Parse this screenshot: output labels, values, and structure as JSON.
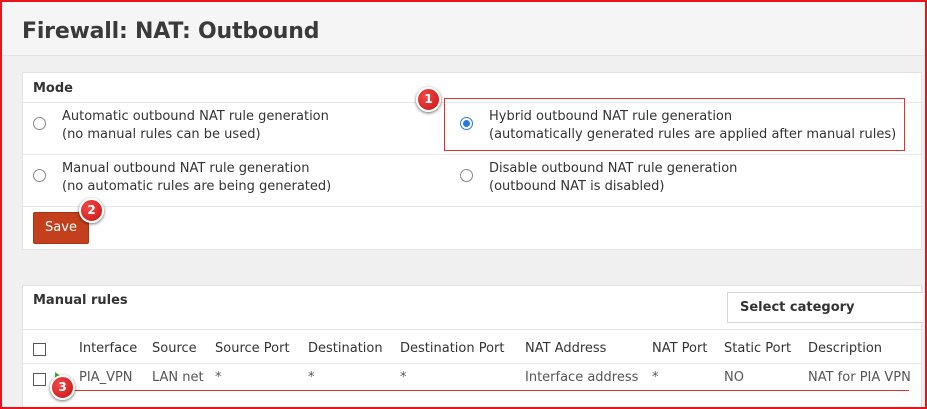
{
  "page": {
    "title": "Firewall: NAT: Outbound"
  },
  "mode": {
    "heading": "Mode",
    "options": [
      {
        "line1": "Automatic outbound NAT rule generation",
        "line2": "(no manual rules can be used)",
        "checked": false
      },
      {
        "line1": "Hybrid outbound NAT rule generation",
        "line2": "(automatically generated rules are applied after manual rules)",
        "checked": true
      },
      {
        "line1": "Manual outbound NAT rule generation",
        "line2": "(no automatic rules are being generated)",
        "checked": false
      },
      {
        "line1": "Disable outbound NAT rule generation",
        "line2": "(outbound NAT is disabled)",
        "checked": false
      }
    ],
    "save_label": "Save"
  },
  "rules": {
    "heading": "Manual rules",
    "category_select": "Select category",
    "columns": [
      "Interface",
      "Source",
      "Source Port",
      "Destination",
      "Destination Port",
      "NAT Address",
      "NAT Port",
      "Static Port",
      "Description"
    ],
    "rows": [
      {
        "interface": "PIA_VPN",
        "source": "LAN net",
        "source_port": "*",
        "destination": "*",
        "destination_port": "*",
        "nat_address": "Interface address",
        "nat_port": "*",
        "static_port": "NO",
        "description": "NAT for PIA VPN"
      }
    ]
  },
  "markers": [
    "1",
    "2",
    "3"
  ],
  "colors": {
    "accent": "#c4401d",
    "highlight": "#e03030",
    "radio": "#2b7ad9"
  }
}
